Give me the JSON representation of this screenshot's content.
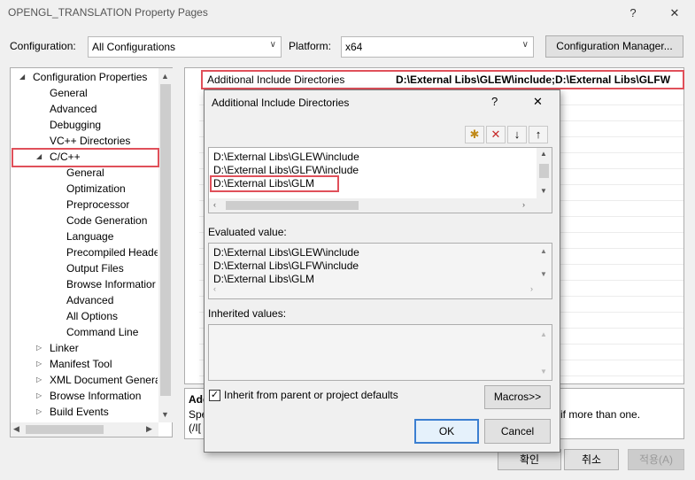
{
  "window": {
    "title": "OPENGL_TRANSLATION Property Pages",
    "help_glyph": "?",
    "close_glyph": "✕"
  },
  "config_bar": {
    "configuration_label": "Configuration:",
    "configuration_value": "All Configurations",
    "platform_label": "Platform:",
    "platform_value": "x64",
    "manager_button": "Configuration Manager..."
  },
  "tree": {
    "items": [
      {
        "label": "Configuration Properties",
        "expander": "◢"
      },
      {
        "label": "General"
      },
      {
        "label": "Advanced"
      },
      {
        "label": "Debugging"
      },
      {
        "label": "VC++ Directories"
      },
      {
        "label": "C/C++",
        "expander": "◢"
      },
      {
        "label": "General"
      },
      {
        "label": "Optimization"
      },
      {
        "label": "Preprocessor"
      },
      {
        "label": "Code Generation"
      },
      {
        "label": "Language"
      },
      {
        "label": "Precompiled Heade"
      },
      {
        "label": "Output Files"
      },
      {
        "label": "Browse Informatior"
      },
      {
        "label": "Advanced"
      },
      {
        "label": "All Options"
      },
      {
        "label": "Command Line"
      },
      {
        "label": "Linker",
        "expander": "▷"
      },
      {
        "label": "Manifest Tool",
        "expander": "▷"
      },
      {
        "label": "XML Document Genera",
        "expander": "▷"
      },
      {
        "label": "Browse Information",
        "expander": "▷"
      },
      {
        "label": "Build Events",
        "expander": "▷"
      }
    ]
  },
  "grid": {
    "property_name": "Additional Include Directories",
    "property_value": "D:\\External Libs\\GLEW\\include;D:\\External Libs\\GLFW",
    "fragment_paren": ")",
    "desc_title": "Add",
    "desc_line1": "Spe",
    "desc_line1_right": "if more than one.",
    "desc_line2": "(/I["
  },
  "dialog": {
    "title": "Additional Include Directories",
    "help_glyph": "?",
    "close_glyph": "✕",
    "directories": [
      "D:\\External Libs\\GLEW\\include",
      "D:\\External Libs\\GLFW\\include",
      "D:\\External Libs\\GLM"
    ],
    "evaluated_label": "Evaluated value:",
    "evaluated": [
      "D:\\External Libs\\GLEW\\include",
      "D:\\External Libs\\GLFW\\include",
      "D:\\External Libs\\GLM"
    ],
    "inherited_label": "Inherited values:",
    "inherit_checkbox_label": "Inherit from parent or project defaults",
    "inherit_checked": true,
    "macros_button": "Macros>>",
    "ok_button": "OK",
    "cancel_button": "Cancel"
  },
  "footer": {
    "confirm_button": "확인",
    "cancel_button": "취소",
    "apply_button": "적용(A)"
  }
}
